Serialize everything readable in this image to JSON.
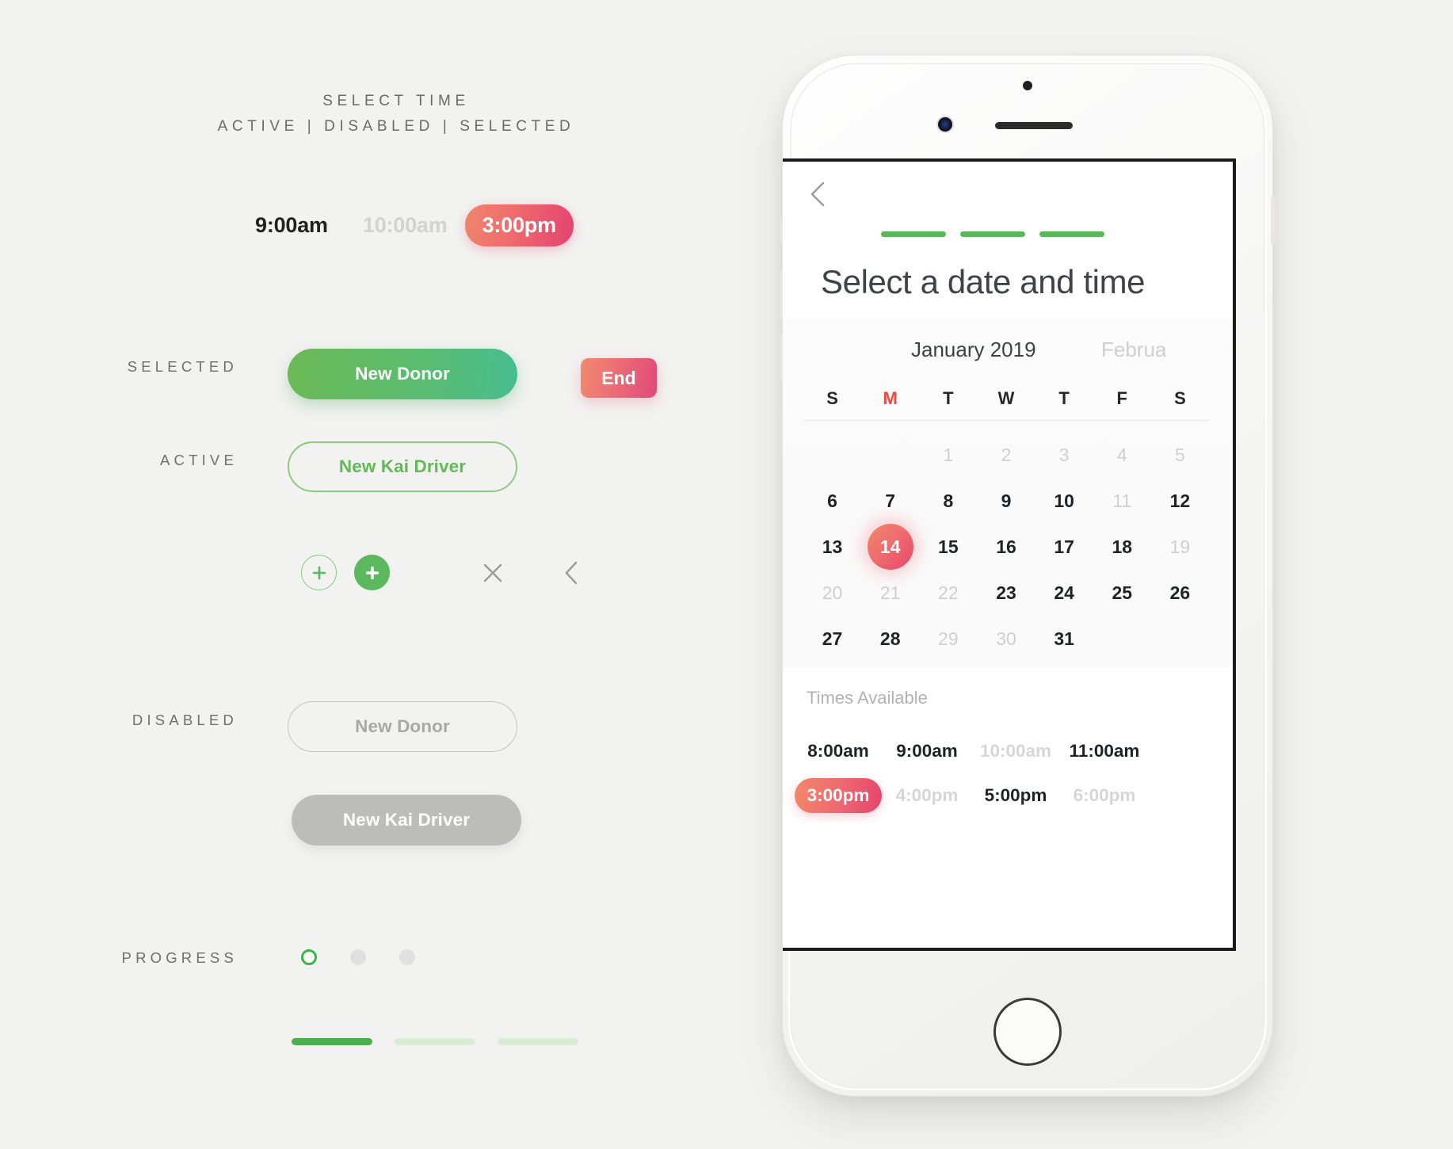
{
  "spec": {
    "heading_line1": "SELECT TIME",
    "heading_line2": "ACTIVE | DISABLED | SELECTED",
    "time_chips": [
      {
        "label": "9:00am",
        "state": "active"
      },
      {
        "label": "10:00am",
        "state": "disabled"
      },
      {
        "label": "3:00pm",
        "state": "selected"
      }
    ],
    "labels": {
      "selected": "SELECTED",
      "active": "ACTIVE",
      "disabled": "DISABLED",
      "progress": "PROGRESS"
    },
    "buttons": {
      "selected_button": "New Donor",
      "end_button": "End",
      "active_button": "New Kai Driver",
      "disabled_outline_button": "New Donor",
      "disabled_fill_button": "New Kai Driver"
    },
    "icons": [
      {
        "name": "plus-circle-outline-icon"
      },
      {
        "name": "plus-circle-filled-icon"
      },
      {
        "name": "close-icon"
      },
      {
        "name": "chevron-left-icon"
      }
    ],
    "progress": {
      "dots": [
        "on",
        "off",
        "off"
      ],
      "bars": [
        "on",
        "off",
        "off"
      ]
    }
  },
  "phone": {
    "screen": {
      "back_icon": "chevron-left-icon",
      "step_bars": 3,
      "title": "Select a date and time",
      "calendar": {
        "current_month": "January 2019",
        "next_month": "Februa",
        "weekdays": [
          {
            "label": "S",
            "highlight": false
          },
          {
            "label": "M",
            "highlight": true
          },
          {
            "label": "T",
            "highlight": false
          },
          {
            "label": "W",
            "highlight": false
          },
          {
            "label": "T",
            "highlight": false
          },
          {
            "label": "F",
            "highlight": false
          },
          {
            "label": "S",
            "highlight": false
          }
        ],
        "weeks": [
          [
            {
              "day": "",
              "state": "empty"
            },
            {
              "day": "",
              "state": "empty"
            },
            {
              "day": "1",
              "state": "disabled"
            },
            {
              "day": "2",
              "state": "disabled"
            },
            {
              "day": "3",
              "state": "disabled"
            },
            {
              "day": "4",
              "state": "disabled"
            },
            {
              "day": "5",
              "state": "disabled"
            }
          ],
          [
            {
              "day": "6",
              "state": "active"
            },
            {
              "day": "7",
              "state": "active"
            },
            {
              "day": "8",
              "state": "active"
            },
            {
              "day": "9",
              "state": "active"
            },
            {
              "day": "10",
              "state": "active"
            },
            {
              "day": "11",
              "state": "disabled"
            },
            {
              "day": "12",
              "state": "active"
            }
          ],
          [
            {
              "day": "13",
              "state": "active"
            },
            {
              "day": "14",
              "state": "selected"
            },
            {
              "day": "15",
              "state": "active"
            },
            {
              "day": "16",
              "state": "active"
            },
            {
              "day": "17",
              "state": "active"
            },
            {
              "day": "18",
              "state": "active"
            },
            {
              "day": "19",
              "state": "disabled"
            }
          ],
          [
            {
              "day": "20",
              "state": "disabled"
            },
            {
              "day": "21",
              "state": "disabled"
            },
            {
              "day": "22",
              "state": "disabled"
            },
            {
              "day": "23",
              "state": "active"
            },
            {
              "day": "24",
              "state": "active"
            },
            {
              "day": "25",
              "state": "active"
            },
            {
              "day": "26",
              "state": "active"
            }
          ],
          [
            {
              "day": "27",
              "state": "active"
            },
            {
              "day": "28",
              "state": "active"
            },
            {
              "day": "29",
              "state": "disabled"
            },
            {
              "day": "30",
              "state": "disabled"
            },
            {
              "day": "31",
              "state": "active"
            },
            {
              "day": "",
              "state": "empty"
            },
            {
              "day": "",
              "state": "empty"
            }
          ]
        ]
      },
      "times": {
        "label": "Times Available",
        "rows": [
          [
            {
              "label": "8:00am",
              "state": "active"
            },
            {
              "label": "9:00am",
              "state": "active"
            },
            {
              "label": "10:00am",
              "state": "disabled"
            },
            {
              "label": "11:00am",
              "state": "active"
            }
          ],
          [
            {
              "label": "3:00pm",
              "state": "selected"
            },
            {
              "label": "4:00pm",
              "state": "disabled"
            },
            {
              "label": "5:00pm",
              "state": "active"
            },
            {
              "label": "6:00pm",
              "state": "disabled"
            }
          ]
        ]
      }
    }
  },
  "colors": {
    "background": "#f2f2f1",
    "green": "#5bb85a",
    "green_gradient_start": "#6cba56",
    "green_gradient_end": "#48bd90",
    "red_gradient_start": "#f2886a",
    "red_gradient_end": "#e6446d",
    "highlight_red": "#ef4a42",
    "disabled_gray": "#bcbdb8",
    "muted_text": "#cfcfcf"
  }
}
